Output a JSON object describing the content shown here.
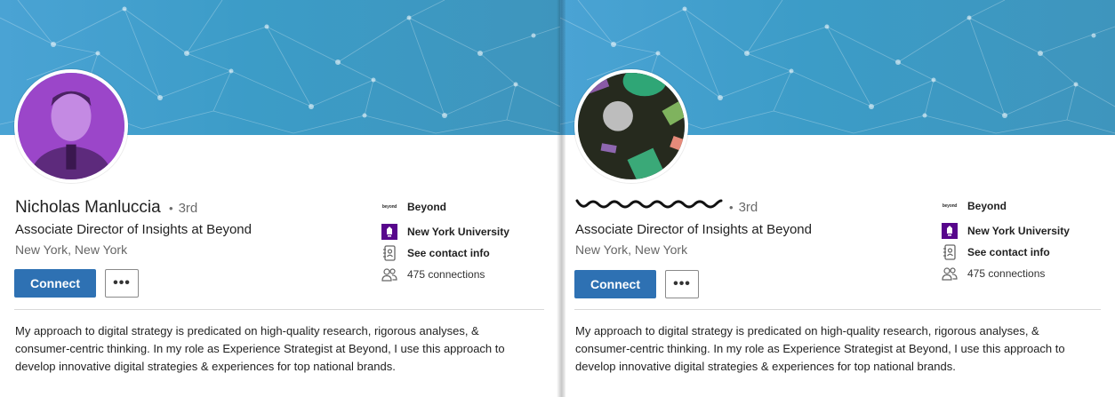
{
  "profiles": [
    {
      "name": "Nicholas Manluccia",
      "degree": "3rd",
      "headline": "Associate Director of Insights at Beyond",
      "location": "New York, New York",
      "connect_label": "Connect",
      "more_label": "•••",
      "company_logo_text": "beyond",
      "company": "Beyond",
      "school": "New York University",
      "contact": "See contact info",
      "connections": "475 connections",
      "summary": [
        "My approach to digital strategy is predicated on high-quality research, rigorous analyses, &",
        "consumer-centric thinking. In my role as Experience Strategist at Beyond, I use this approach to",
        "develop innovative digital strategies & experiences for top national brands."
      ]
    },
    {
      "degree": "3rd",
      "headline": "Associate Director of Insights at Beyond",
      "location": "New York, New York",
      "connect_label": "Connect",
      "more_label": "•••",
      "company_logo_text": "beyond",
      "company": "Beyond",
      "school": "New York University",
      "contact": "See contact info",
      "connections": "475 connections",
      "summary": [
        "My approach to digital strategy is predicated on high-quality research, rigorous analyses, &",
        "consumer-centric thinking. In my role as Experience Strategist at Beyond, I use this approach to",
        "develop innovative digital strategies & experiences for top national brands."
      ]
    }
  ],
  "colors": {
    "banner": "#3e9dc8",
    "connect_button": "#2e71b3",
    "nyu_purple": "#57068c",
    "avatar_purple": "#9b46c9"
  }
}
